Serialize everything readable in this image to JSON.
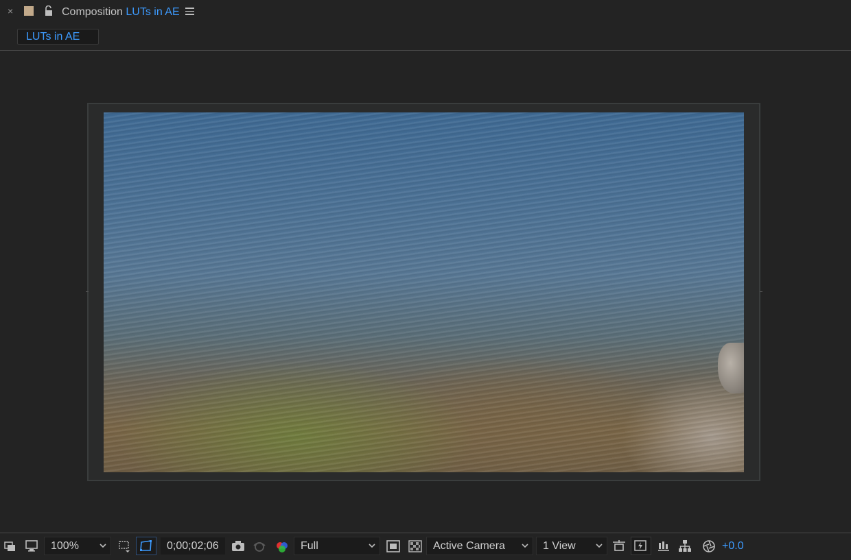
{
  "panel": {
    "title_prefix": "Composition",
    "composition_name": "LUTs in AE",
    "close_label": "×",
    "swatch_color": "#c2a98a",
    "accent_color": "#3d9bff"
  },
  "tabs": [
    {
      "label": "LUTs in AE",
      "active": true
    }
  ],
  "toolbar": {
    "magnification": "100%",
    "timecode": "0;00;02;06",
    "resolution": "Full",
    "camera_view": "Active Camera",
    "view_layout": "1 View",
    "exposure": "+0.0"
  },
  "icons": [
    "close-icon",
    "lock-icon",
    "panel-menu-icon",
    "always-preview-icon",
    "display-icon",
    "region-of-interest-icon",
    "mask-visibility-icon",
    "snapshot-icon",
    "show-snapshot-icon",
    "color-channels-icon",
    "fast-previews-icon",
    "transparency-grid-icon",
    "toggle-pixel-aspect-icon",
    "reset-exposure-icon",
    "timeline-icon",
    "flowchart-icon",
    "exposure-icon"
  ]
}
